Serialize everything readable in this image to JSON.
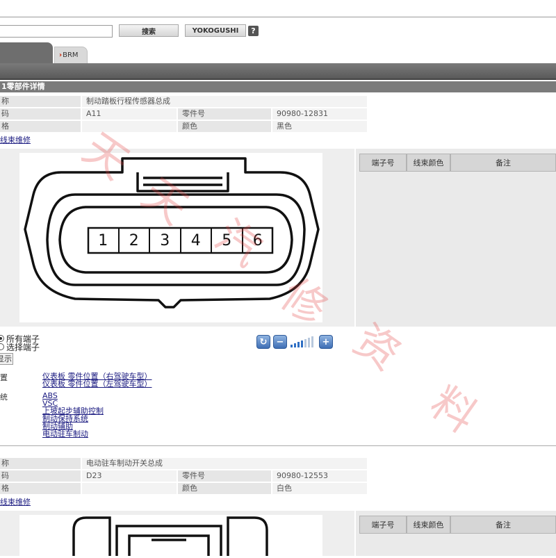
{
  "toolbar": {
    "search_value": "",
    "search_button": "搜索",
    "yokogushi_button": "YOKOGUSHI",
    "help": "?"
  },
  "tabs": [
    {
      "label": ""
    },
    {
      "label": "BRM"
    }
  ],
  "sections": [
    {
      "title": "1零部件详情",
      "rows": {
        "name_label": "称",
        "name_value": "制动踏板行程传感器总成",
        "code_label": "码",
        "code_value": "A11",
        "part_no_label": "零件号",
        "part_no_value": "90980-12831",
        "spec_label": "格",
        "color_label": "颜色",
        "color_value": "黑色"
      },
      "repair_link": "线束维修",
      "table_headers": [
        "端子号",
        "线束颜色",
        "备注"
      ],
      "connector_pins": [
        "1",
        "2",
        "3",
        "4",
        "5",
        "6"
      ],
      "radio_all": "所有端子",
      "radio_select": "选择端子",
      "show_button": "显示",
      "location_label": "置",
      "locations": [
        "仪表板 零件位置（右驾驶车型）",
        "仪表板 零件位置（左驾驶车型）"
      ],
      "system_label": "统",
      "systems": [
        "ABS",
        "VSC",
        "上坡起步辅助控制",
        "制动保持系统",
        "制动辅助",
        "电动驻车制动"
      ]
    },
    {
      "rows": {
        "name_label": "称",
        "name_value": "电动驻车制动开关总成",
        "code_label": "码",
        "code_value": "D23",
        "part_no_label": "零件号",
        "part_no_value": "90980-12553",
        "spec_label": "格",
        "color_label": "颜色",
        "color_value": "白色"
      },
      "repair_link": "线束维修",
      "table_headers": [
        "端子号",
        "线束颜色",
        "备注"
      ]
    }
  ],
  "watermark": [
    "天",
    "天",
    "汽",
    "修",
    "资",
    "料"
  ],
  "colors": {
    "section_bar": "#7b7b7b",
    "watermark": "#e13c3c",
    "zoom_accent": "#3f6fb5"
  }
}
